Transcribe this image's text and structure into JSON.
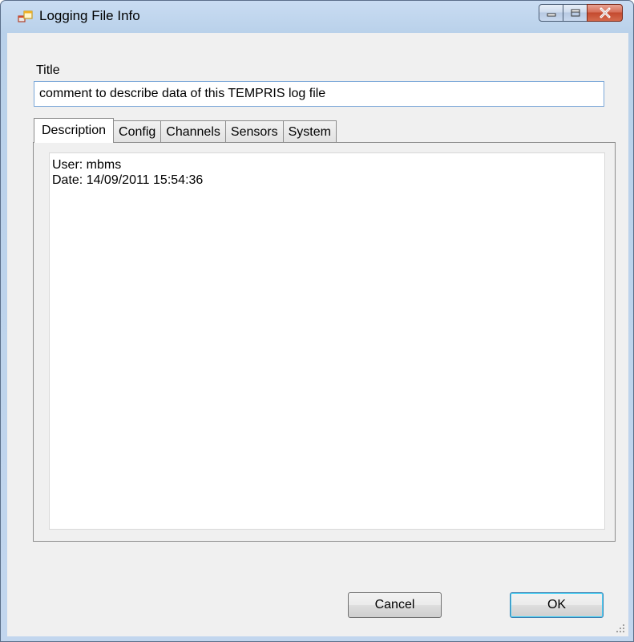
{
  "window": {
    "title": "Logging File Info",
    "icon": "app-window-icon",
    "caption_buttons": [
      "minimize-icon",
      "maximize-icon",
      "close-icon"
    ]
  },
  "form": {
    "title_label": "Title",
    "title_value": "comment to describe data of this TEMPRIS log file"
  },
  "tabs": [
    {
      "label": "Description",
      "active": true
    },
    {
      "label": "Config",
      "active": false
    },
    {
      "label": "Channels",
      "active": false
    },
    {
      "label": "Sensors",
      "active": false
    },
    {
      "label": "System",
      "active": false
    }
  ],
  "description": {
    "line1": "User: mbms",
    "line2": "Date: 14/09/2011 15:54:36"
  },
  "buttons": {
    "cancel": "Cancel",
    "ok": "OK"
  },
  "colors": {
    "titlebar": "#b9d1ea",
    "client": "#f0f0f0",
    "close_button": "#c44a2f"
  }
}
